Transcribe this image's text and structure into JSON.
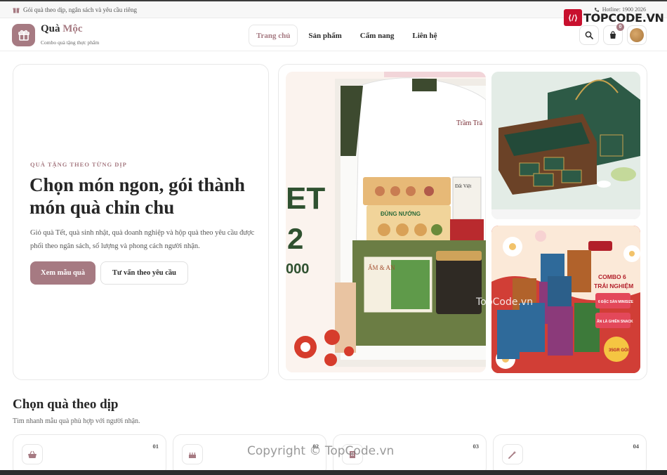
{
  "topbar": {
    "promo": "Gói quà theo dịp, ngân sách và yêu cầu riêng",
    "hotline": "Hotline: 1900 2026"
  },
  "watermark": {
    "logo_text": "TOPCODE.VN",
    "center": "TopCode.vn",
    "copyright": "Copyright © TopCode.vn"
  },
  "header": {
    "brand_main": "Quà",
    "brand_accent": "Mộc",
    "brand_sub": "Combo quà tặng thực phẩm",
    "nav": [
      "Trang chủ",
      "Sản phẩm",
      "Cẩm nang",
      "Liên hệ"
    ],
    "active_nav": "Trang chủ",
    "cart_count": "0",
    "icons": [
      "search-icon",
      "cart-icon",
      "user-avatar"
    ]
  },
  "hero": {
    "eyebrow": "QUÀ TẶNG THEO TỪNG DỊP",
    "title": "Chọn món ngon, gói thành món quà chỉn chu",
    "description": "Giỏ quà Tết, quà sinh nhật, quà doanh nghiệp và hộp quà theo yêu cầu được phối theo ngân sách, số lượng và phong cách người nhận.",
    "primary_button": "Xem mẫu quà",
    "secondary_button": "Tư vấn theo yêu cầu"
  },
  "gallery": {
    "main_overlay": [
      "ET",
      "2",
      "000"
    ],
    "main_tags": [
      "Đất Việt",
      "ĐỦNG NƯỚNG",
      "ẤM & AN",
      "Trầm Trà"
    ],
    "side_bottom_tags": [
      "COMBO 6",
      "TRẢI NGHIỆM",
      "6 ĐẶC SẢN MINISIZE",
      "ĂN LÀ GHIỀN SNACK",
      "35GR GÓI"
    ]
  },
  "occasions": {
    "title": "Chọn quà theo dịp",
    "subtitle": "Tìm nhanh mẫu quà phù hợp với người nhận.",
    "items": [
      {
        "num": "01",
        "icon": "basket-icon"
      },
      {
        "num": "02",
        "icon": "cake-icon"
      },
      {
        "num": "03",
        "icon": "building-icon"
      },
      {
        "num": "04",
        "icon": "magic-wand-icon"
      }
    ]
  },
  "colors": {
    "accent": "#a67a82",
    "text": "#262626"
  }
}
